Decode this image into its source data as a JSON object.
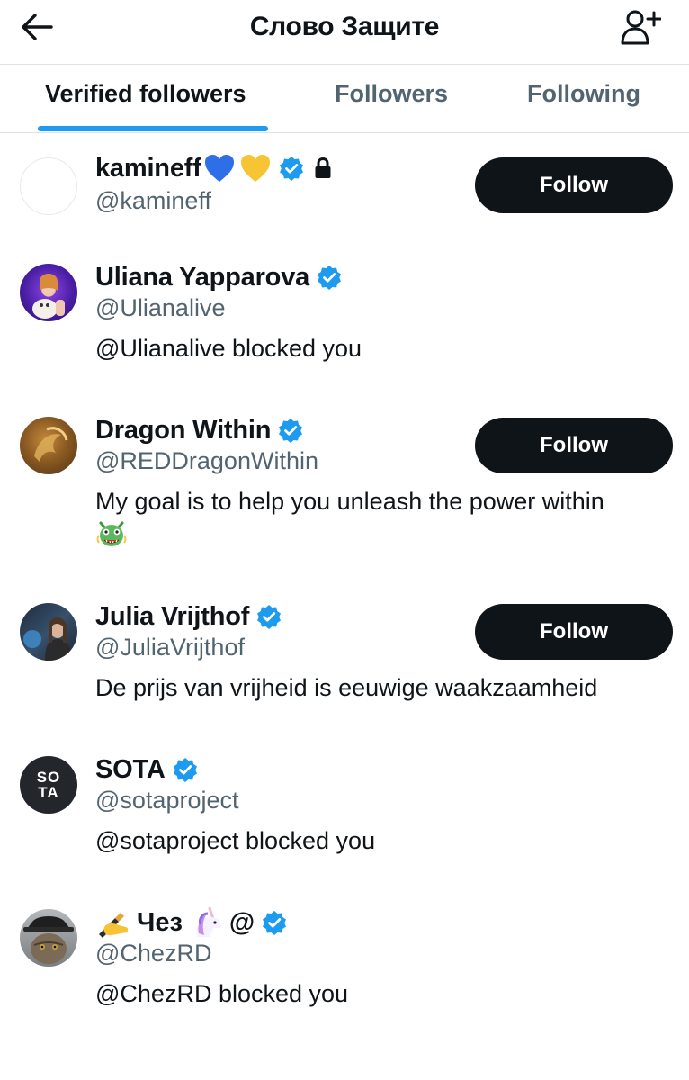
{
  "header": {
    "title": "Слово Защите",
    "back_icon": "arrow-left-icon",
    "add_icon": "person-add-icon"
  },
  "tabs": [
    {
      "label": "Verified followers",
      "active": true
    },
    {
      "label": "Followers",
      "active": false
    },
    {
      "label": "Following",
      "active": false
    }
  ],
  "colors": {
    "accent": "#1d9bf0",
    "verified_badge": "#1d9bf0",
    "follow_button_bg": "#0f1419",
    "secondary_text": "#536471"
  },
  "users": [
    {
      "name": "kamineff",
      "handle": "@kamineff",
      "bio": "",
      "follow_label": "Follow",
      "icons": [
        "blue-heart-emoji",
        "yellow-heart-emoji",
        "verified-badge-icon",
        "lock-icon"
      ]
    },
    {
      "name": "Uliana Yapparova",
      "handle": "@Ulianalive",
      "bio": "@Ulianalive blocked you",
      "icons": [
        "verified-badge-icon"
      ]
    },
    {
      "name": "Dragon Within",
      "handle": "@REDDragonWithin",
      "bio": "My goal is to help you unleash the power within",
      "follow_label": "Follow",
      "icons": [
        "verified-badge-icon",
        "dragon-face-emoji"
      ]
    },
    {
      "name": "Julia Vrijthof",
      "handle": "@JuliaVrijthof",
      "bio": "De prijs van vrijheid is eeuwige waakzaamheid",
      "follow_label": "Follow",
      "icons": [
        "verified-badge-icon"
      ]
    },
    {
      "name": "SOTA",
      "handle": "@sotaproject",
      "bio": "@sotaproject blocked you",
      "avatar_text_top": "SO",
      "avatar_text_bottom": "TA",
      "icons": [
        "verified-badge-icon"
      ]
    },
    {
      "name_parts": [
        "Чез",
        "@"
      ],
      "handle": "@ChezRD",
      "bio": "@ChezRD blocked you",
      "icons": [
        "writing-hand-emoji",
        "unicorn-emoji",
        "verified-badge-icon"
      ]
    }
  ]
}
